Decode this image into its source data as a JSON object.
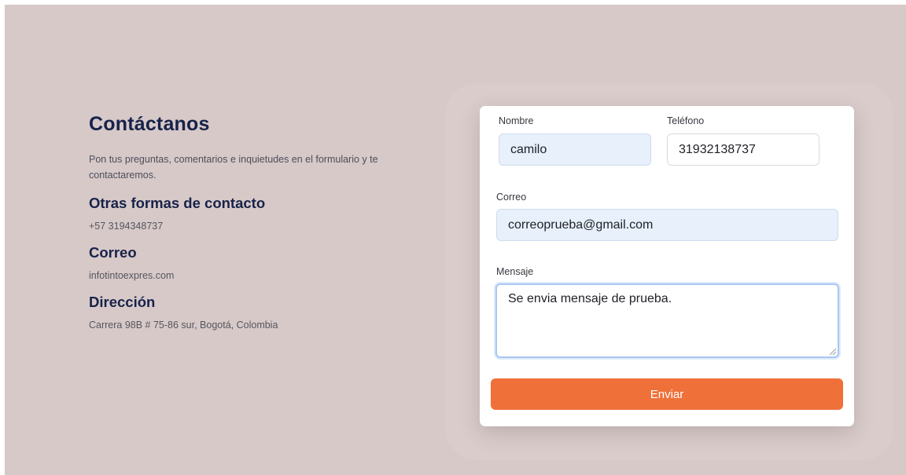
{
  "info": {
    "title": "Contáctanos",
    "description": "Pon tus preguntas, comentarios e inquietudes en el formulario y te contactaremos.",
    "sections": [
      {
        "heading": "Otras formas de contacto",
        "value": "+57 3194348737"
      },
      {
        "heading": "Correo",
        "value": "infotintoexpres.com"
      },
      {
        "heading": "Dirección",
        "value": "Carrera 98B # 75-86 sur, Bogotá, Colombia"
      }
    ]
  },
  "form": {
    "nombre": {
      "label": "Nombre",
      "value": "camilo"
    },
    "telefono": {
      "label": "Teléfono",
      "value": "31932138737"
    },
    "correo": {
      "label": "Correo",
      "value": "correoprueba@gmail.com"
    },
    "mensaje": {
      "label": "Mensaje",
      "value": "Se envia mensaje de prueba."
    },
    "submit_label": "Enviar"
  },
  "colors": {
    "background": "#d7c9c8",
    "heading": "#17224a",
    "button": "#f0703a",
    "filled_field": "#e7f0fb"
  }
}
